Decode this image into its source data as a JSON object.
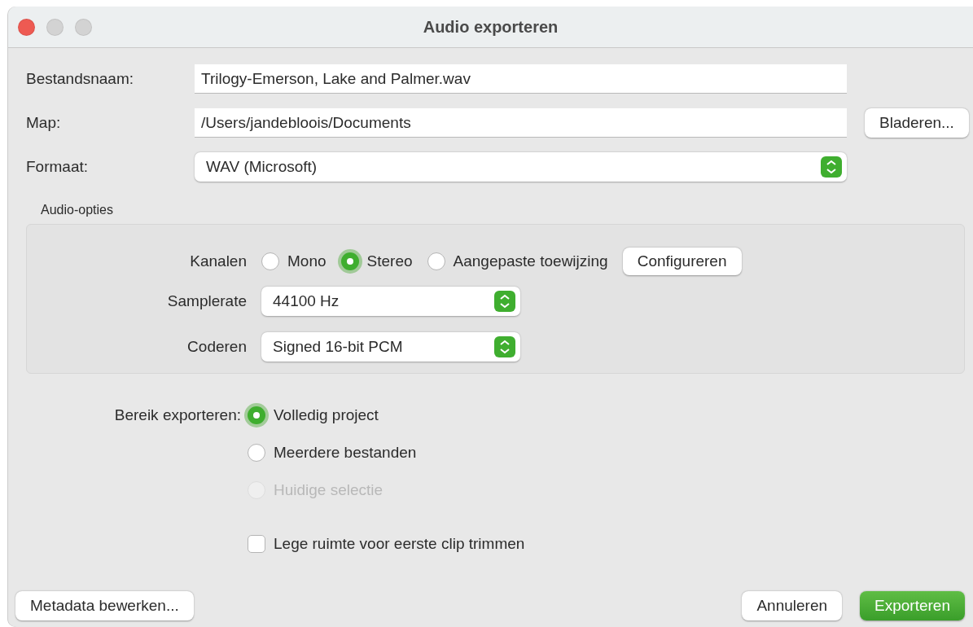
{
  "window": {
    "title": "Audio exporteren"
  },
  "form_rows": [
    {
      "kind": "text",
      "label": "Bestandsnaam:",
      "value": "Trilogy-Emerson, Lake and Palmer.wav"
    },
    {
      "kind": "text",
      "label": "Map:",
      "value": "/Users/jandebloois/Documents",
      "button": "Bladeren..."
    },
    {
      "kind": "select",
      "label": "Formaat:",
      "value": "WAV (Microsoft)"
    }
  ],
  "audio_options": {
    "title": "Audio-opties",
    "channels": {
      "label": "Kanalen",
      "options": [
        {
          "label": "Mono",
          "selected": false
        },
        {
          "label": "Stereo",
          "selected": true
        },
        {
          "label": "Aangepaste toewijzing",
          "selected": false
        }
      ],
      "button": "Configureren"
    },
    "selects": [
      {
        "label": "Samplerate",
        "value": "44100 Hz"
      },
      {
        "label": "Coderen",
        "value": "Signed 16-bit PCM"
      }
    ]
  },
  "export_range": {
    "label": "Bereik exporteren:",
    "options": [
      {
        "label": "Volledig project",
        "selected": true,
        "disabled": false
      },
      {
        "label": "Meerdere bestanden",
        "selected": false,
        "disabled": false
      },
      {
        "label": "Huidige selectie",
        "selected": false,
        "disabled": true
      }
    ]
  },
  "trim_checkbox": {
    "label": "Lege ruimte voor eerste clip trimmen",
    "checked": false
  },
  "buttons": {
    "metadata": "Metadata bewerken...",
    "cancel": "Annuleren",
    "export": "Exporteren"
  }
}
